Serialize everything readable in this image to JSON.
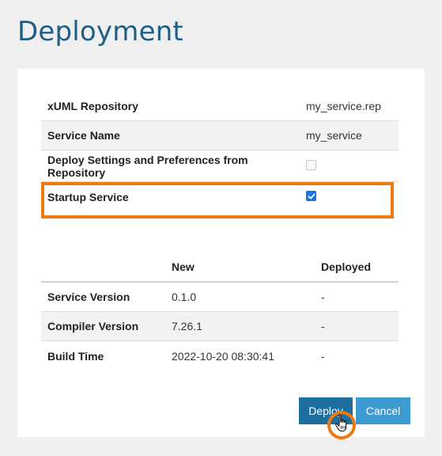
{
  "page": {
    "title": "Deployment"
  },
  "settings": {
    "rows": [
      {
        "label": "xUML Repository",
        "value": "my_service.rep"
      },
      {
        "label": "Service Name",
        "value": "my_service"
      },
      {
        "label": "Deploy Settings and Preferences from Repository",
        "checked": false
      },
      {
        "label": "Startup Service",
        "checked": true
      }
    ]
  },
  "versions": {
    "headers": [
      "",
      "New",
      "Deployed"
    ],
    "rows": [
      {
        "label": "Service Version",
        "new": "0.1.0",
        "deployed": "-"
      },
      {
        "label": "Compiler Version",
        "new": "7.26.1",
        "deployed": "-"
      },
      {
        "label": "Build Time",
        "new": "2022-10-20 08:30:41",
        "deployed": "-"
      }
    ]
  },
  "actions": {
    "deploy_label": "Deploy",
    "cancel_label": "Cancel"
  },
  "colors": {
    "title": "#1f5f86",
    "highlight": "#ec7a10",
    "deploy_button": "#1c6f9f",
    "cancel_button": "#3d9bd1"
  }
}
